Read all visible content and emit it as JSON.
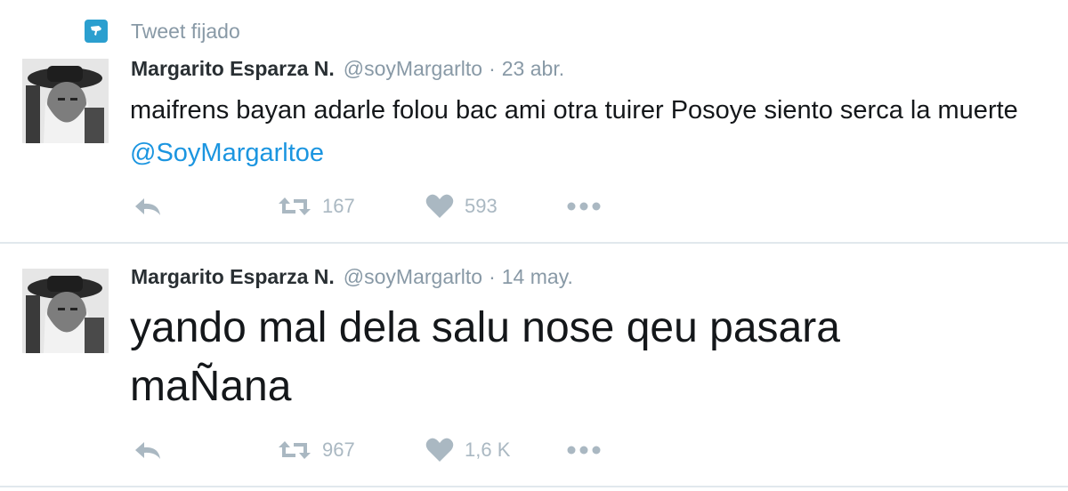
{
  "pinned": {
    "label": "Tweet fijado",
    "icon": "pin-icon"
  },
  "colors": {
    "accent": "#1b95e0",
    "pin_badge": "#2b9fcf",
    "muted_text": "#8899a6",
    "action_icon": "#aab8c2",
    "divider": "#e1e8ed"
  },
  "tweets": [
    {
      "author": {
        "name": "Margarito Esparza N.",
        "handle": "@soyMargarlto",
        "avatar": "avatar-image"
      },
      "separator": "·",
      "date": "23 abr.",
      "text": "maifrens bayan adarle folou bac ami otra tuirer Posoye siento serca la muerte ",
      "mention": "@SoyMargarltoe",
      "actions": {
        "reply_icon": "reply-icon",
        "retweet_icon": "retweet-icon",
        "retweet_count": "167",
        "like_icon": "heart-icon",
        "like_count": "593",
        "more_icon": "more-icon"
      }
    },
    {
      "author": {
        "name": "Margarito Esparza N.",
        "handle": "@soyMargarlto",
        "avatar": "avatar-image"
      },
      "separator": "·",
      "date": "14 may.",
      "text": "yando mal dela salu nose qeu pasara maÑana",
      "actions": {
        "reply_icon": "reply-icon",
        "retweet_icon": "retweet-icon",
        "retweet_count": "967",
        "like_icon": "heart-icon",
        "like_count": "1,6 K",
        "more_icon": "more-icon"
      }
    }
  ]
}
